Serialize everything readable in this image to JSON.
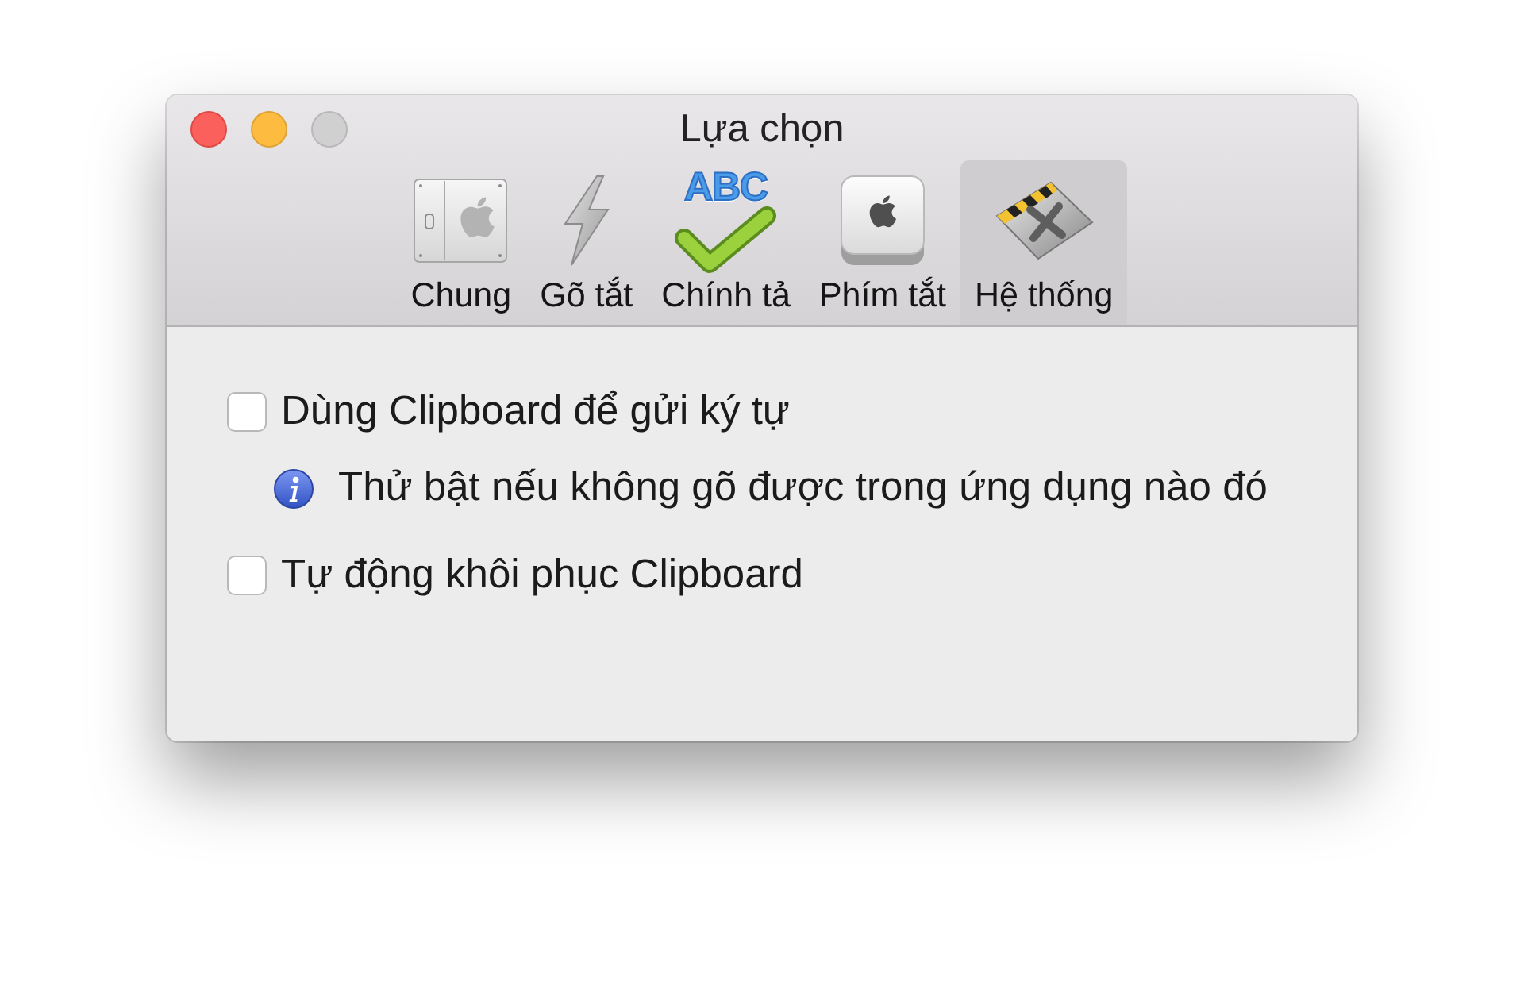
{
  "window": {
    "title": "Lựa chọn"
  },
  "tabs": [
    {
      "label": "Chung",
      "selected": false
    },
    {
      "label": "Gõ tắt",
      "selected": false
    },
    {
      "label": "Chính tả",
      "icon_text": "ABC",
      "selected": false
    },
    {
      "label": "Phím tắt",
      "selected": false
    },
    {
      "label": "Hệ thống",
      "selected": true
    }
  ],
  "options": [
    {
      "kind": "checkbox",
      "label": "Dùng Clipboard để gửi ký tự",
      "checked": false
    },
    {
      "kind": "info",
      "text": "Thử bật nếu không gõ được trong ứng dụng nào đó"
    },
    {
      "kind": "checkbox",
      "label": "Tự động khôi phục Clipboard",
      "checked": false
    }
  ]
}
